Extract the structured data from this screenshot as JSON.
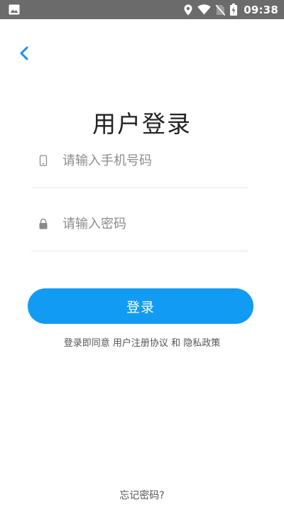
{
  "status_bar": {
    "time": "09:38",
    "icons": [
      "gallery-icon",
      "location-icon",
      "wifi-icon",
      "no-sim-icon",
      "battery-charging-icon"
    ],
    "background": "#6b6b6b"
  },
  "header": {
    "back_icon": "chevron-left-icon",
    "accent_color": "#1d8ee8"
  },
  "title": "用户登录",
  "form": {
    "phone": {
      "icon": "phone-icon",
      "value": "",
      "placeholder": "请输入手机号码"
    },
    "password": {
      "icon": "lock-icon",
      "value": "",
      "placeholder": "请输入密码"
    }
  },
  "login_button": {
    "label": "登录",
    "color": "#129bf3"
  },
  "agreement": {
    "prefix": "登录即同意",
    "user_agreement": "用户注册协议",
    "conjunction": "和",
    "privacy_policy": "隐私政策"
  },
  "forgot_password": "忘记密码?"
}
